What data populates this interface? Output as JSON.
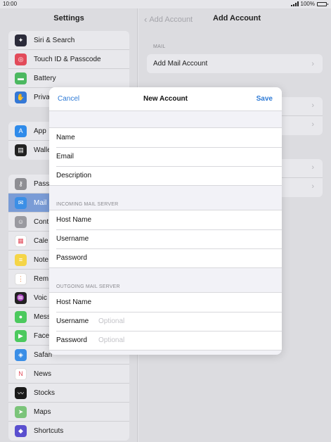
{
  "status_bar": {
    "time": "10:00",
    "battery": "100%"
  },
  "sidebar": {
    "title": "Settings",
    "group1": [
      {
        "label": "Siri & Search",
        "icon": "siri-icon",
        "color": "#2b2b3a"
      },
      {
        "label": "Touch ID & Passcode",
        "icon": "fingerprint-icon",
        "color": "#e24b5a"
      },
      {
        "label": "Battery",
        "icon": "battery-icon",
        "color": "#4cb860"
      },
      {
        "label": "Priva",
        "icon": "hand-icon",
        "color": "#3478d6"
      }
    ],
    "group2": [
      {
        "label": "App",
        "icon": "app-store-icon",
        "color": "#2f8bea"
      },
      {
        "label": "Walle",
        "icon": "wallet-icon",
        "color": "#222222"
      }
    ],
    "group3": [
      {
        "label": "Pass",
        "icon": "key-icon",
        "color": "#8e8e93"
      },
      {
        "label": "Mail",
        "icon": "mail-icon",
        "color": "#3b8fe6",
        "selected": true
      },
      {
        "label": "Cont",
        "icon": "contacts-icon",
        "color": "#9a9aa0"
      },
      {
        "label": "Cale",
        "icon": "calendar-icon",
        "color": "#ffffff"
      },
      {
        "label": "Note",
        "icon": "notes-icon",
        "color": "#f5d547"
      },
      {
        "label": "Rem",
        "icon": "reminders-icon",
        "color": "#ffffff"
      },
      {
        "label": "Voic",
        "icon": "voice-memos-icon",
        "color": "#222222"
      },
      {
        "label": "Mess",
        "icon": "messages-icon",
        "color": "#4cc95e"
      },
      {
        "label": "Face",
        "icon": "facetime-icon",
        "color": "#4cc95e"
      },
      {
        "label": "Safari",
        "icon": "safari-icon",
        "color": "#3a8ee6"
      },
      {
        "label": "News",
        "icon": "news-icon",
        "color": "#ffffff"
      },
      {
        "label": "Stocks",
        "icon": "stocks-icon",
        "color": "#1a1a1a"
      },
      {
        "label": "Maps",
        "icon": "maps-icon",
        "color": "#7bc47a"
      },
      {
        "label": "Shortcuts",
        "icon": "shortcuts-icon",
        "color": "#5a4fcf"
      }
    ]
  },
  "detail": {
    "back_label": "Add Account",
    "title": "Add Account",
    "section_mail": "MAIL",
    "add_mail_account": "Add Mail Account"
  },
  "modal": {
    "cancel": "Cancel",
    "title": "New Account",
    "save": "Save",
    "fields": {
      "name": "Name",
      "email": "Email",
      "description": "Description"
    },
    "incoming": {
      "header": "INCOMING MAIL SERVER",
      "host_name": "Host Name",
      "username": "Username",
      "password": "Password"
    },
    "outgoing": {
      "header": "OUTGOING MAIL SERVER",
      "host_name": "Host Name",
      "username": "Username",
      "username_placeholder": "Optional",
      "password": "Password",
      "password_placeholder": "Optional"
    }
  },
  "colors": {
    "accent": "#2f7bd6"
  }
}
